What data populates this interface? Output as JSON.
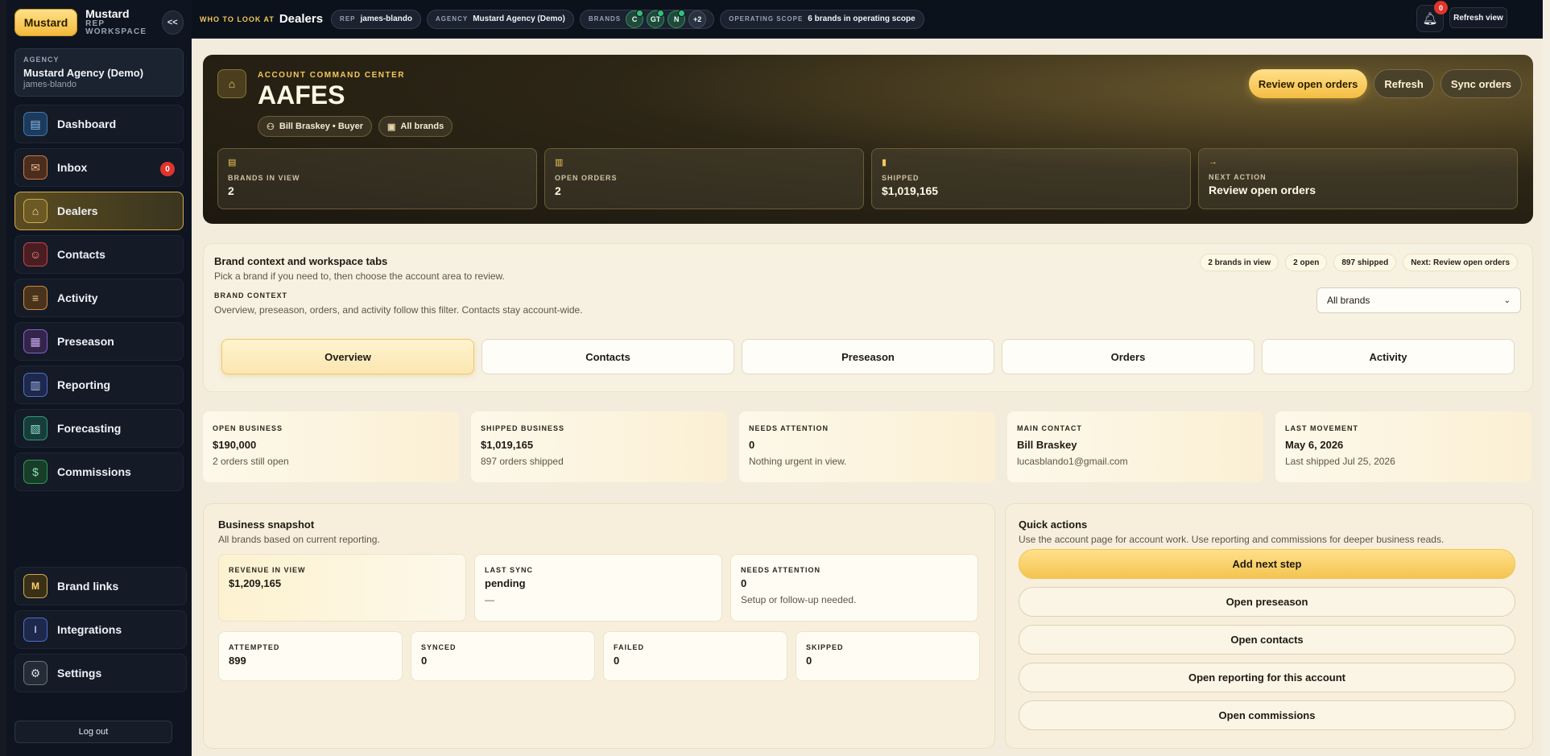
{
  "sidebar": {
    "logo_label": "Mustard",
    "brand_title": "Mustard",
    "brand_subtitle": "REP WORKSPACE",
    "collapse_label": "<<",
    "agency": {
      "label": "AGENCY",
      "name": "Mustard Agency (Demo)",
      "user": "james-blando"
    },
    "items": [
      {
        "label": "Dashboard",
        "icon": "dashboard-icon",
        "color": "#3a7bbd"
      },
      {
        "label": "Inbox",
        "icon": "inbox-icon",
        "color": "#d07a44",
        "badge": "0"
      },
      {
        "label": "Dealers",
        "icon": "home-icon",
        "color": "#d2a94a"
      },
      {
        "label": "Contacts",
        "icon": "people-icon",
        "color": "#c8464d"
      },
      {
        "label": "Activity",
        "icon": "activity-icon",
        "color": "#d08a3c"
      },
      {
        "label": "Preseason",
        "icon": "calendar-icon",
        "color": "#8a5fd0"
      },
      {
        "label": "Reporting",
        "icon": "report-icon",
        "color": "#4f6fd0"
      },
      {
        "label": "Forecasting",
        "icon": "forecast-icon",
        "color": "#2f9a8a"
      },
      {
        "label": "Commissions",
        "icon": "dollar-icon",
        "color": "#2f9a5a"
      }
    ],
    "bottom_items": [
      {
        "label": "Brand links",
        "glyph": "M",
        "color": "#d2a94a"
      },
      {
        "label": "Integrations",
        "glyph": "I",
        "color": "#4f6fd0"
      },
      {
        "label": "Settings",
        "glyph": "⚙",
        "color": "#8a93a3"
      }
    ],
    "logout": "Log out"
  },
  "topbar": {
    "who_label": "WHO TO LOOK AT",
    "who_value": "Dealers",
    "rep_key": "REP",
    "rep_value": "james-blando",
    "agency_key": "AGENCY",
    "agency_value": "Mustard Agency (Demo)",
    "brands_key": "BRANDS",
    "brand_chips": [
      "C",
      "GT",
      "N"
    ],
    "brand_more": "+2",
    "scope_key": "OPERATING SCOPE",
    "scope_value": "6 brands in operating scope",
    "notif_count": "0",
    "refresh_view": "Refresh view"
  },
  "hero": {
    "kicker": "ACCOUNT COMMAND CENTER",
    "title": "AAFES",
    "buyer_tag": "Bill Braskey • Buyer",
    "brands_tag": "All brands",
    "actions": {
      "review": "Review open orders",
      "refresh": "Refresh",
      "sync": "Sync orders"
    },
    "stats": [
      {
        "label": "BRANDS IN VIEW",
        "value": "2"
      },
      {
        "label": "OPEN ORDERS",
        "value": "2"
      },
      {
        "label": "SHIPPED",
        "value": "$1,019,165"
      },
      {
        "label": "NEXT ACTION",
        "value": "Review open orders"
      }
    ]
  },
  "context": {
    "title": "Brand context and workspace tabs",
    "subtitle": "Pick a brand if you need to, then choose the account area to review.",
    "brand_context_label": "BRAND CONTEXT",
    "brand_context_note": "Overview, preseason, orders, and activity follow this filter. Contacts stay account-wide.",
    "pills": [
      "2 brands in view",
      "2 open",
      "897 shipped",
      "Next: Review open orders"
    ],
    "select_value": "All brands",
    "tabs": [
      "Overview",
      "Contacts",
      "Preseason",
      "Orders",
      "Activity"
    ]
  },
  "kpis": [
    {
      "label": "OPEN BUSINESS",
      "value": "$190,000",
      "sub": "2 orders still open"
    },
    {
      "label": "SHIPPED BUSINESS",
      "value": "$1,019,165",
      "sub": "897 orders shipped"
    },
    {
      "label": "NEEDS ATTENTION",
      "value": "0",
      "sub": "Nothing urgent in view."
    },
    {
      "label": "MAIN CONTACT",
      "value": "Bill Braskey",
      "sub": "lucasblando1@gmail.com"
    },
    {
      "label": "LAST MOVEMENT",
      "value": "May 6, 2026",
      "sub": "Last shipped Jul 25, 2026"
    }
  ],
  "snapshot": {
    "title": "Business snapshot",
    "subtitle": "All brands based on current reporting.",
    "row1": [
      {
        "label": "REVENUE IN VIEW",
        "value": "$1,209,165",
        "sub": ""
      },
      {
        "label": "LAST SYNC",
        "value": "pending",
        "sub": "—"
      },
      {
        "label": "NEEDS ATTENTION",
        "value": "0",
        "sub": "Setup or follow-up needed."
      }
    ],
    "row2": [
      {
        "label": "ATTEMPTED",
        "value": "899"
      },
      {
        "label": "SYNCED",
        "value": "0"
      },
      {
        "label": "FAILED",
        "value": "0"
      },
      {
        "label": "SKIPPED",
        "value": "0"
      }
    ]
  },
  "quick_actions": {
    "title": "Quick actions",
    "subtitle": "Use the account page for account work. Use reporting and commissions for deeper business reads.",
    "buttons": [
      "Add next step",
      "Open preseason",
      "Open contacts",
      "Open reporting for this account",
      "Open commissions"
    ]
  }
}
